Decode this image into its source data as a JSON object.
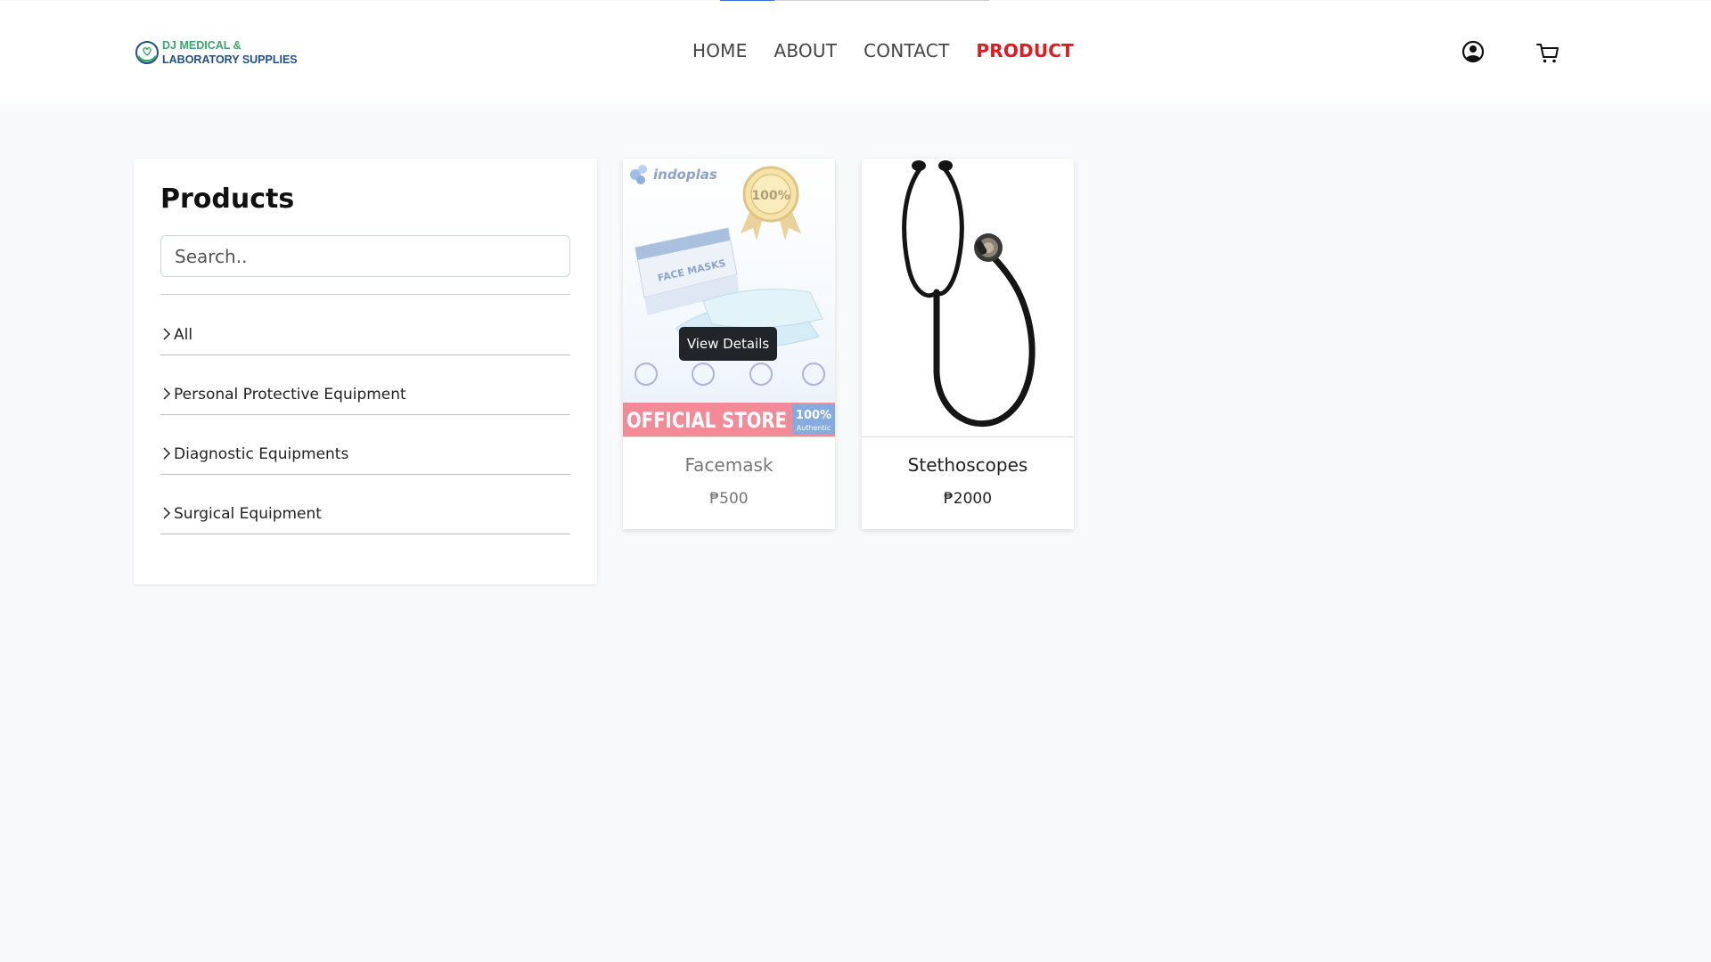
{
  "brand": {
    "line1": "DJ MEDICAL &",
    "line2": "LABORATORY SUPPLIES",
    "colors": {
      "green": "#3aa66a",
      "blue": "#1f4f8f"
    }
  },
  "nav": {
    "items": [
      {
        "label": "HOME",
        "active": false
      },
      {
        "label": "ABOUT",
        "active": false
      },
      {
        "label": "CONTACT",
        "active": false
      },
      {
        "label": "PRODUCT",
        "active": true
      }
    ],
    "active_color": "#e3191f"
  },
  "header_icons": [
    "user-circle-icon",
    "cart-icon"
  ],
  "sidebar": {
    "title": "Products",
    "search_placeholder": "Search..",
    "categories": [
      {
        "label": "All"
      },
      {
        "label": "Personal Protective Equipment"
      },
      {
        "label": "Diagnostic Equipments"
      },
      {
        "label": "Surgical Equipment"
      }
    ]
  },
  "products": [
    {
      "name": "Facemask",
      "price": "₱500",
      "hover_button": "View Details",
      "image": {
        "brand": "indoplas",
        "seal": "100%",
        "box_text": "FACE MASKS",
        "banner": "OFFICIAL STORE",
        "badge_top": "100%",
        "badge_bottom": "Authentic"
      }
    },
    {
      "name": "Stethoscopes",
      "price": "₱2000",
      "image": {
        "icon": "stethoscope-image"
      }
    }
  ]
}
